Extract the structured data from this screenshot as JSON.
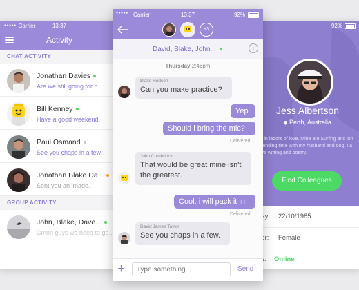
{
  "left": {
    "status": {
      "carrier": "Carrier",
      "time": "13:37"
    },
    "title": "Activity",
    "chat_section": "CHAT ACTIVITY",
    "chats": [
      {
        "name": "Jonathan Davies",
        "message": "Are we still going for c...",
        "dot": "#4cd964"
      },
      {
        "name": "Bill Kenney",
        "message": "Have a good weekend.",
        "dot": "#4cd964"
      },
      {
        "name": "Paul Osmand",
        "message": "See you chaps in a few.",
        "dot": "#c7c7cc"
      },
      {
        "name": "Jonathan Blake Da...",
        "message": "Sent you an image.",
        "dot": "#f5a623"
      }
    ],
    "group_section": "GROUP ACTIVITY",
    "group": {
      "name": "John, Blake, Dave...",
      "message": "Cmon guys we need to go...",
      "dot": "#4cd964"
    }
  },
  "center": {
    "status": {
      "carrier": "Carrier",
      "time": "13:37",
      "battery": "92%"
    },
    "extra_count": "+3",
    "participants": "David, Blake, John...",
    "day": "Thursday",
    "time": "2:46pm",
    "messages": [
      {
        "sender": "Blake Hodson",
        "text": "Can you make practice?"
      },
      {
        "text": "Yep"
      },
      {
        "text": "Should i bring the mic?",
        "status": "Delivered"
      },
      {
        "sender": "John Combrinck",
        "text": "That would be great mine isn't the greatest."
      },
      {
        "text": "Cool, i will pack it in",
        "status": "Delivered"
      },
      {
        "sender": "David James Taylor",
        "text": "See you chaps in a few."
      }
    ],
    "input_placeholder": "Type something...",
    "send_label": "Send"
  },
  "right": {
    "status": {
      "battery": "92%"
    },
    "name": "Jess Albertson",
    "location": "Perth, Australia",
    "bio": "ve in labors of love. Mine are Surfing and lon spending time with my husband and dog. I a love writing and poetry.",
    "button": "Find Colleagues",
    "details": [
      {
        "label": "day:",
        "value": "22/10/1985"
      },
      {
        "label": "der:",
        "value": "Female"
      },
      {
        "label": "us:",
        "value": "Online"
      }
    ]
  },
  "colors": {
    "accent": "#9b89d9",
    "green": "#4cd964",
    "online": "#4cd964"
  }
}
